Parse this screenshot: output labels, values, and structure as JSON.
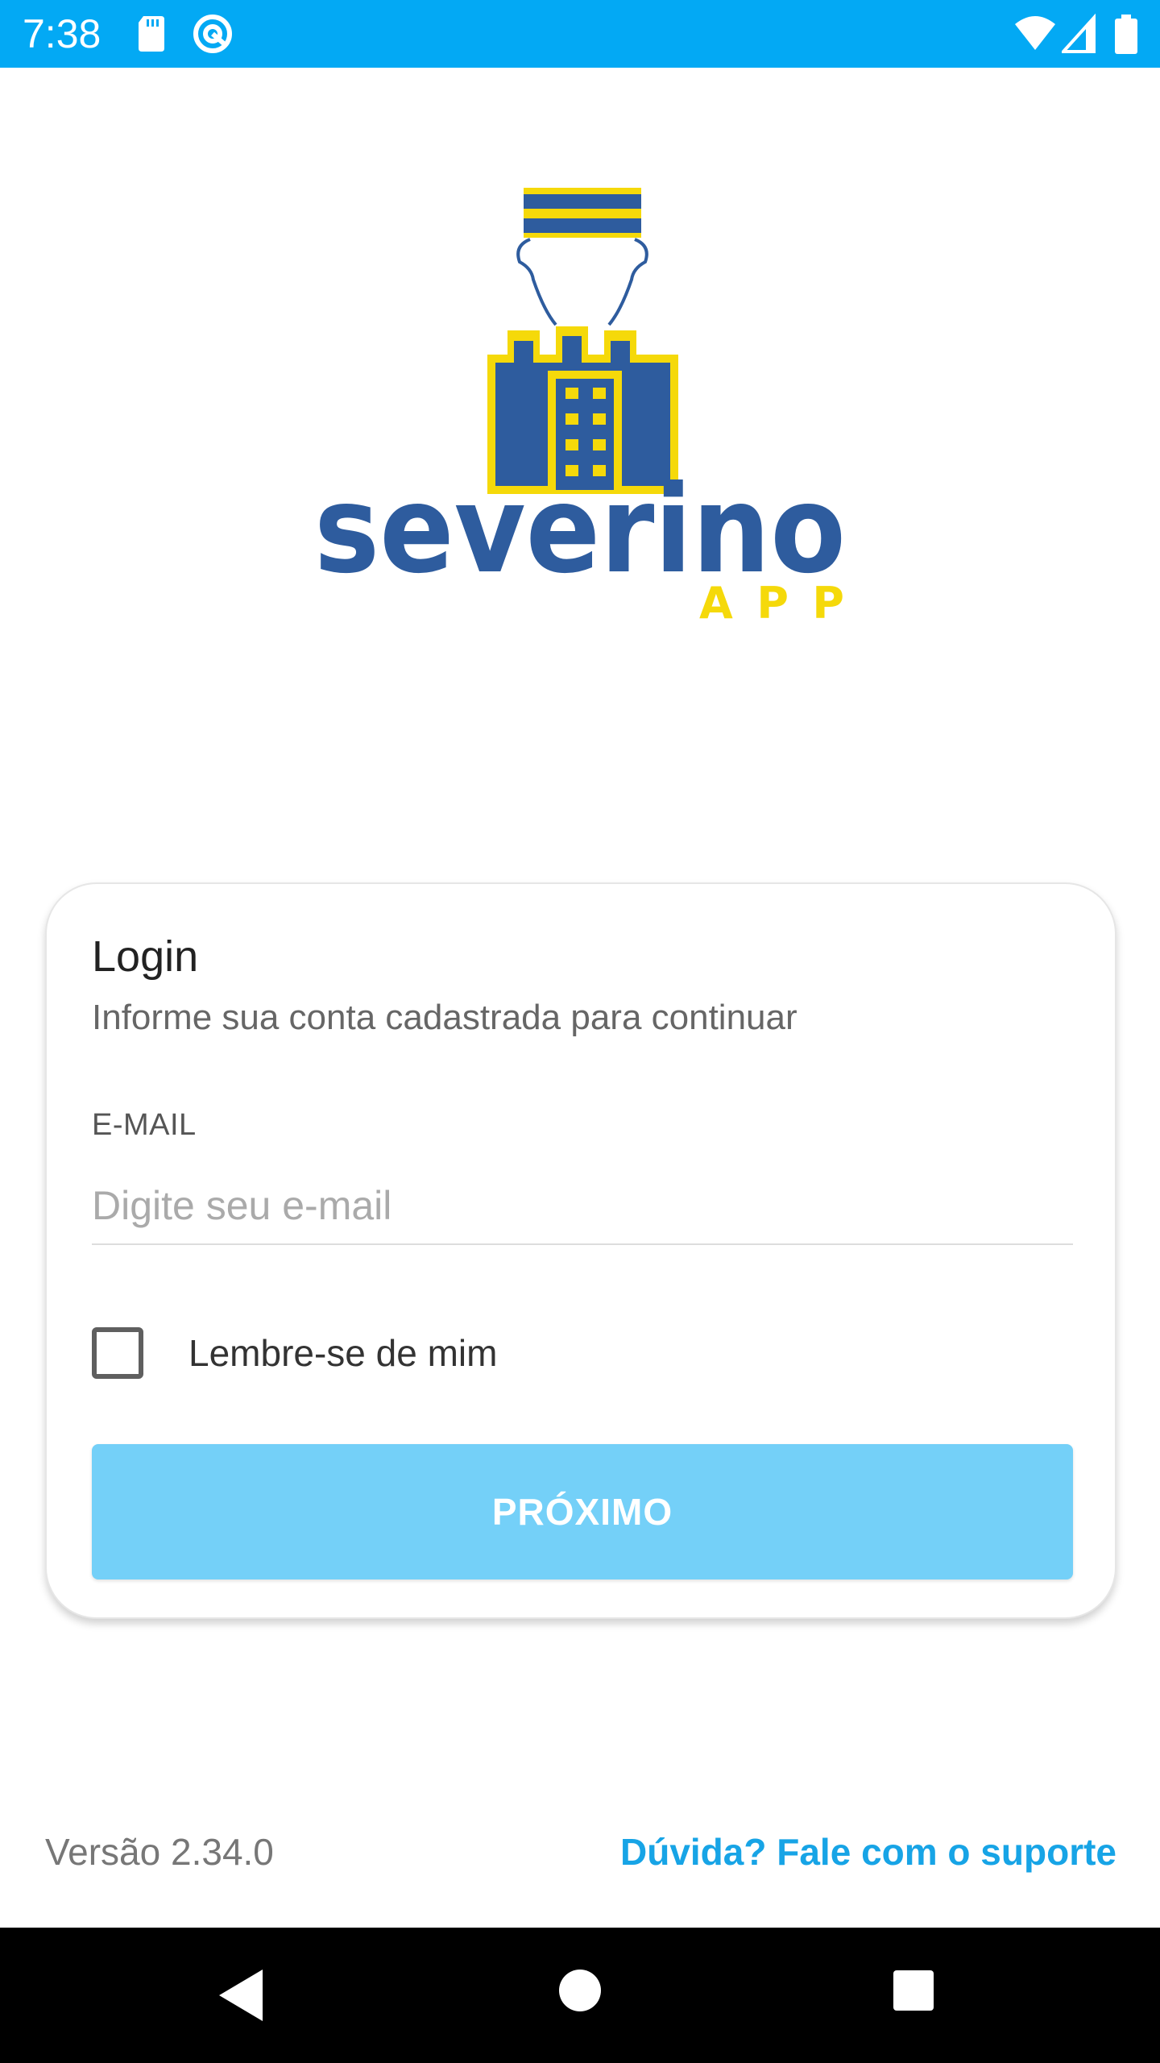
{
  "status_bar": {
    "time": "7:38",
    "background_color": "#03A9F4",
    "icons": [
      "sd-card-icon",
      "sync-icon",
      "wifi-icon",
      "cell-signal-icon",
      "battery-icon"
    ]
  },
  "logo": {
    "name": "severino",
    "sub": "APP",
    "brand_blue": "#2E5C9E",
    "brand_yellow": "#F5D90A"
  },
  "login_card": {
    "title": "Login",
    "subtitle": "Informe sua conta cadastrada para continuar",
    "email": {
      "label": "E-MAIL",
      "value": "",
      "placeholder": "Digite seu e-mail"
    },
    "remember": {
      "label": "Lembre-se de mim",
      "checked": false
    },
    "next_button": {
      "label": "PRÓXIMO",
      "color": "#74D0F8"
    }
  },
  "footer": {
    "version": "Versão 2.34.0",
    "support_link": "Dúvida? Fale com o suporte",
    "link_color": "#17A4E6"
  },
  "nav_bar": {
    "icons": [
      "back-triangle-icon",
      "home-circle-icon",
      "recent-apps-square-icon"
    ]
  }
}
